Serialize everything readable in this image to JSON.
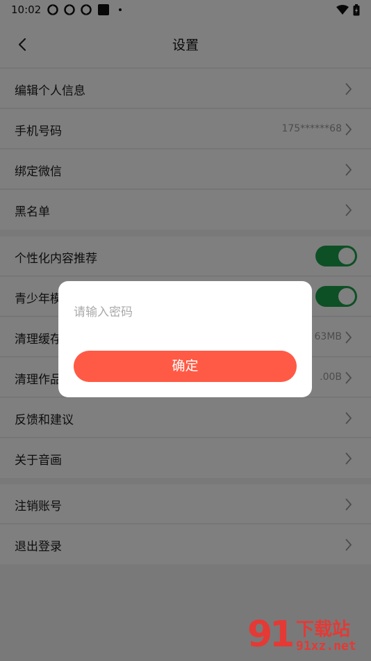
{
  "status_bar": {
    "time": "10:02"
  },
  "header": {
    "title": "设置"
  },
  "sections": [
    {
      "label": "编辑个人信息",
      "value": ""
    },
    {
      "label": "手机号码",
      "value": "175******68"
    },
    {
      "label": "绑定微信",
      "value": ""
    },
    {
      "label": "黑名单",
      "value": ""
    },
    {
      "label": "个性化内容推荐",
      "toggle_on": true
    },
    {
      "label": "青少年模式",
      "toggle_on": true
    },
    {
      "label": "清理缓存",
      "value": "63MB"
    },
    {
      "label": "清理作品",
      "value": ".00B"
    },
    {
      "label": "反馈和建议",
      "value": ""
    },
    {
      "label": "关于音画",
      "value": ""
    },
    {
      "label": "注销账号",
      "value": ""
    },
    {
      "label": "退出登录",
      "value": ""
    }
  ],
  "dialog": {
    "placeholder": "请输入密码",
    "confirm_label": "确定"
  },
  "watermark": {
    "logo": "91",
    "name": "下载站",
    "url": "91xz.net"
  },
  "colors": {
    "toggle_on": "#1aa14a",
    "confirm_button": "#ff5a45",
    "overlay": "rgba(0,0,0,0.5)"
  }
}
